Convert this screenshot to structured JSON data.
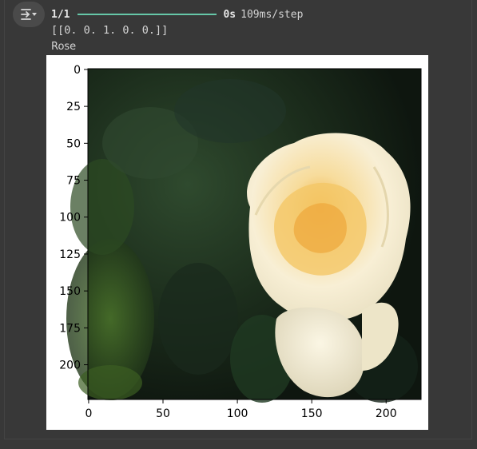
{
  "output": {
    "progress": {
      "step_count": "1/1",
      "fraction": 1.0,
      "elapsed": "0s",
      "step_time": "109ms/step"
    },
    "prediction": "[[0. 0. 1. 0. 0.]]",
    "label": "Rose"
  },
  "icons": {
    "toggle": "output-toggle-icon"
  },
  "colors": {
    "progress": "#66c7a8",
    "background": "#383838"
  },
  "image_plot": {
    "image_width": 224,
    "image_height": 224,
    "x_ticks": [
      "0",
      "50",
      "100",
      "150",
      "200"
    ],
    "y_ticks": [
      "0",
      "25",
      "50",
      "75",
      "100",
      "125",
      "150",
      "175",
      "200"
    ],
    "subject": "photo of a pale yellow rose against dark foliage"
  }
}
